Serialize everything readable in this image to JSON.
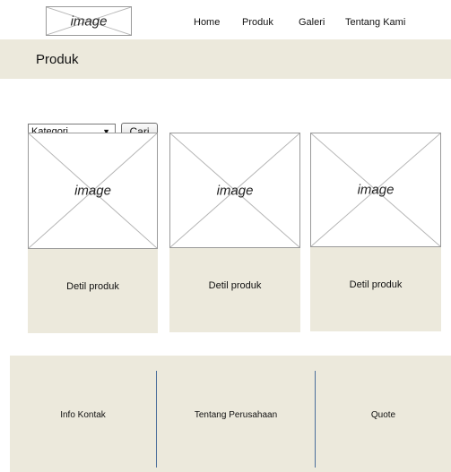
{
  "header": {
    "logo_placeholder": "image",
    "nav": [
      "Home",
      "Produk",
      "Galeri",
      "Tentang Kami"
    ]
  },
  "title_bar": {
    "title": "Produk"
  },
  "filter": {
    "select_value": "Kategori",
    "search_button": "Cari"
  },
  "products": [
    {
      "image_placeholder": "image",
      "detail_label": "Detil produk"
    },
    {
      "image_placeholder": "image",
      "detail_label": "Detil produk"
    },
    {
      "image_placeholder": "image",
      "detail_label": "Detil produk"
    }
  ],
  "footer": {
    "columns": [
      "Info Kontak",
      "Tentang Perusahaan",
      "Quote"
    ]
  }
}
